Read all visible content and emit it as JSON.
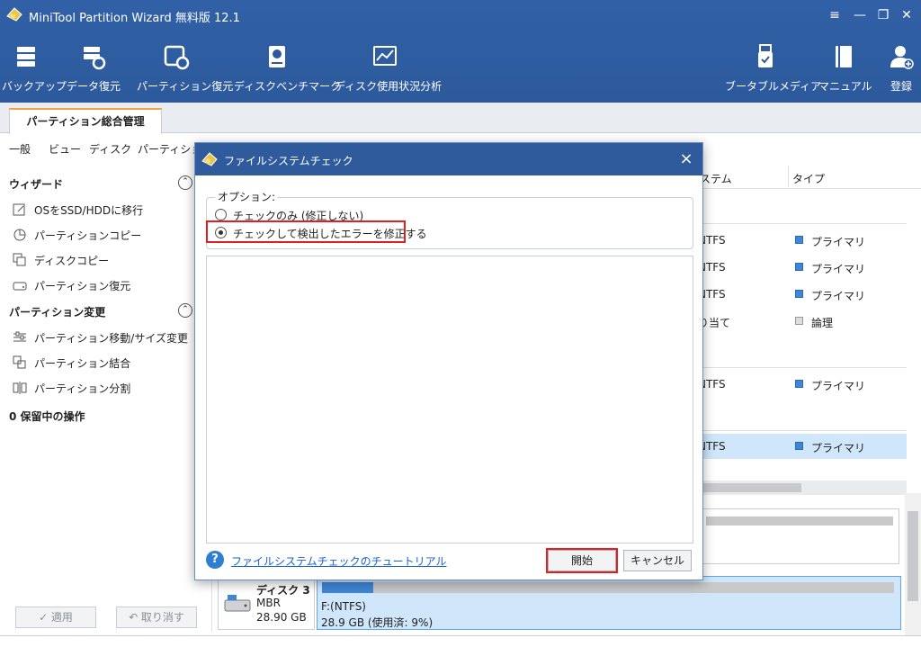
{
  "app": {
    "title": "MiniTool Partition Wizard 無料版 12.1"
  },
  "window_controls": {
    "menu": "≡",
    "minimize": "—",
    "restore": "❐",
    "close": "✕"
  },
  "toolbar": {
    "backup": "バックアップ",
    "data_recovery": "データ復元",
    "partition_recovery": "パーティション復元",
    "disk_benchmark": "ディスクベンチマーク",
    "space_analyzer": "ディスク使用状況分析",
    "bootable_media": "ブータブルメディア",
    "manual": "マニュアル",
    "register": "登録"
  },
  "tabs": {
    "main": "パーティション総合管理"
  },
  "menu": {
    "general": "一般",
    "view": "ビュー",
    "disk": "ディスク",
    "partition": "パーティション"
  },
  "sidebar": {
    "wizard_title": "ウィザード",
    "wizard_items": [
      "OSをSSD/HDDに移行",
      "パーティションコピー",
      "ディスクコピー",
      "パーティション復元"
    ],
    "change_title": "パーティション変更",
    "change_items": [
      "パーティション移動/サイズ変更",
      "パーティション結合",
      "パーティション分割"
    ],
    "pending": "0 保留中の操作",
    "apply": "✓ 適用",
    "undo": "↶ 取り消す"
  },
  "table": {
    "col_filesystem": "ステム",
    "col_type": "タイプ",
    "rows": [
      {
        "fs": "NTFS",
        "type": "プライマリ"
      },
      {
        "fs": "NTFS",
        "type": "プライマリ"
      },
      {
        "fs": "NTFS",
        "type": "プライマリ"
      },
      {
        "fs": "り当て",
        "type": "論理"
      },
      {
        "fs": "NTFS",
        "type": "プライマリ"
      },
      {
        "fs": "NTFS",
        "type": "プライマリ"
      }
    ]
  },
  "disk3": {
    "name": "ディスク 3",
    "scheme": "MBR",
    "size": "28.90 GB",
    "partition_name": "F:(NTFS)",
    "partition_usage": "28.9 GB (使用済: 9%)",
    "used_fraction": 0.09
  },
  "dialog": {
    "title": "ファイルシステムチェック",
    "options_label": "オプション:",
    "option_check_only": "チェックのみ (修正しない)",
    "option_check_fix": "チェックして検出したエラーを修正する",
    "selected_option": "check_fix",
    "help_link": "ファイルシステムチェックのチュートリアル",
    "start": "開始",
    "cancel": "キャンセル"
  },
  "colors": {
    "titlebar": "#2f5b9c",
    "accent": "#f1a33a",
    "highlight": "#e02020",
    "primary_square": "#3f86d6",
    "selection": "#cfe6fb"
  }
}
